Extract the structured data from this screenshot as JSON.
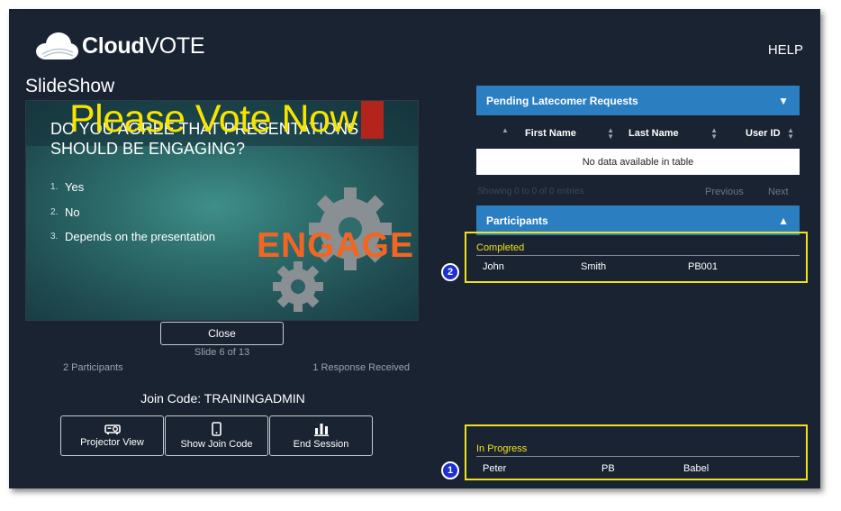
{
  "app": {
    "logo_bold": "Cloud",
    "logo_light": "VOTE",
    "help_label": "HELP"
  },
  "slideshow": {
    "title": "SlideShow",
    "overlay_text": "Please Vote Now",
    "question": "DO YOU AGREE THAT PRESENTATIONS SHOULD BE ENGAGING?",
    "options": [
      {
        "num": "1.",
        "label": "Yes"
      },
      {
        "num": "2.",
        "label": "No"
      },
      {
        "num": "3.",
        "label": "Depends on the presentation"
      }
    ],
    "image_word": "ENGAGE",
    "close_label": "Close",
    "slide_counter": "Slide 6 of 13",
    "participants_count": "2 Participants",
    "responses_count": "1 Response Received",
    "join_code": "Join Code: TRAININGADMIN",
    "actions": {
      "projector": "Projector View",
      "show_join": "Show Join Code",
      "end_session": "End Session"
    }
  },
  "pending": {
    "header": "Pending Latecomer Requests",
    "caret": "▼",
    "columns": [
      "First Name",
      "Last Name",
      "User ID"
    ],
    "no_data": "No data available in table",
    "showing": "Showing 0 to 0 of 0 entries",
    "previous": "Previous",
    "next": "Next"
  },
  "participants": {
    "header": "Participants",
    "caret": "▲",
    "completed": {
      "label": "Completed",
      "badge": "2",
      "rows": [
        {
          "first": "John",
          "last": "Smith",
          "id": "PB001"
        }
      ]
    },
    "in_progress": {
      "label": "In Progress",
      "badge": "1",
      "rows": [
        {
          "first": "Peter",
          "last": "PB",
          "id": "Babel"
        }
      ]
    }
  },
  "colors": {
    "background": "#1a2332",
    "accent_blue": "#2b7fc1",
    "highlight_yellow": "#f0e31a",
    "overlay_yellow": "#f7e400",
    "engage_orange": "#f26522"
  }
}
